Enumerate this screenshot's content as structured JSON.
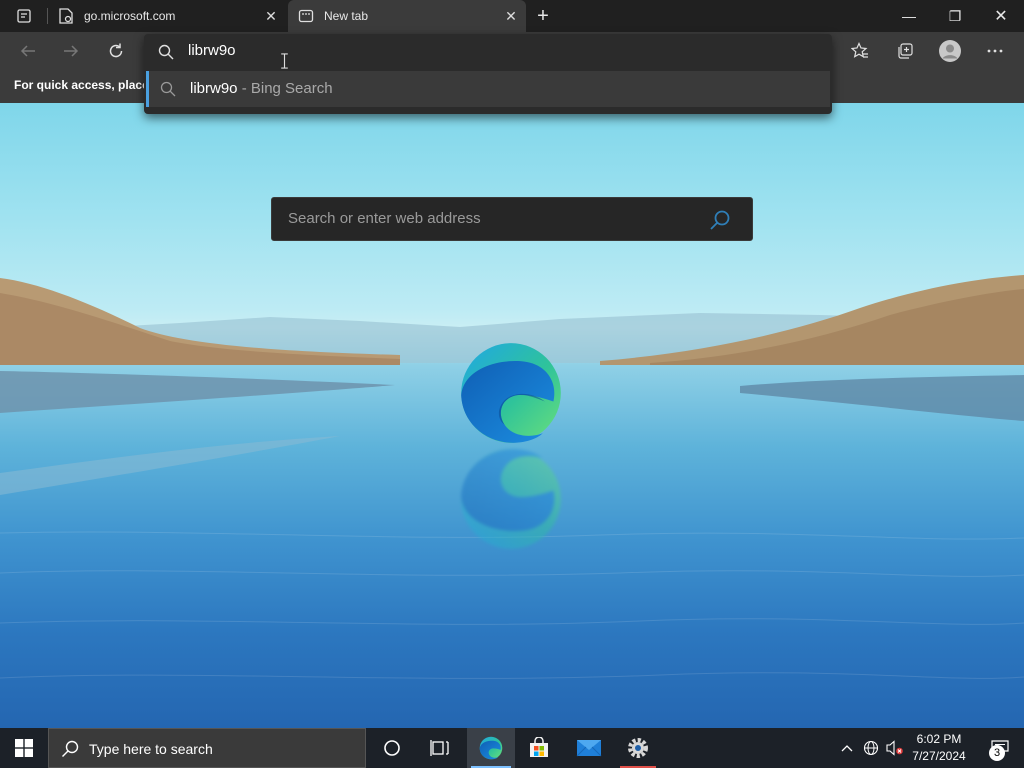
{
  "browser": {
    "tabs": [
      {
        "title": "go.microsoft.com",
        "icon": "document-icon",
        "active": false
      },
      {
        "title": "New tab",
        "icon": "newtab-icon",
        "active": true
      }
    ],
    "new_tab_symbol": "+",
    "window_controls": {
      "minimize": "—",
      "restore": "❐",
      "close": "✕"
    }
  },
  "toolbar": {
    "buttons": [
      "back-icon",
      "forward-icon",
      "refresh-icon",
      "favorites-icon",
      "collections-icon",
      "profile-icon",
      "more-icon"
    ]
  },
  "favorites_bar": {
    "hint": "For quick access, place y"
  },
  "address_bar": {
    "value": "librw9o",
    "suggestion": {
      "query": "librw9o",
      "suffix": " - Bing Search"
    }
  },
  "new_tab_page": {
    "search_placeholder": "Search or enter web address"
  },
  "taskbar": {
    "search_placeholder": "Type here to search",
    "apps": [
      "cortana-icon",
      "task-view-icon",
      "edge-icon",
      "store-icon",
      "mail-icon",
      "settings-icon"
    ],
    "clock": {
      "time": "6:02 PM",
      "date": "7/27/2024"
    },
    "notifications_count": "3"
  },
  "colors": {
    "accent": "#4aa0e0",
    "taskbar": "#1c2128",
    "toolbar": "#3b3b3b"
  }
}
